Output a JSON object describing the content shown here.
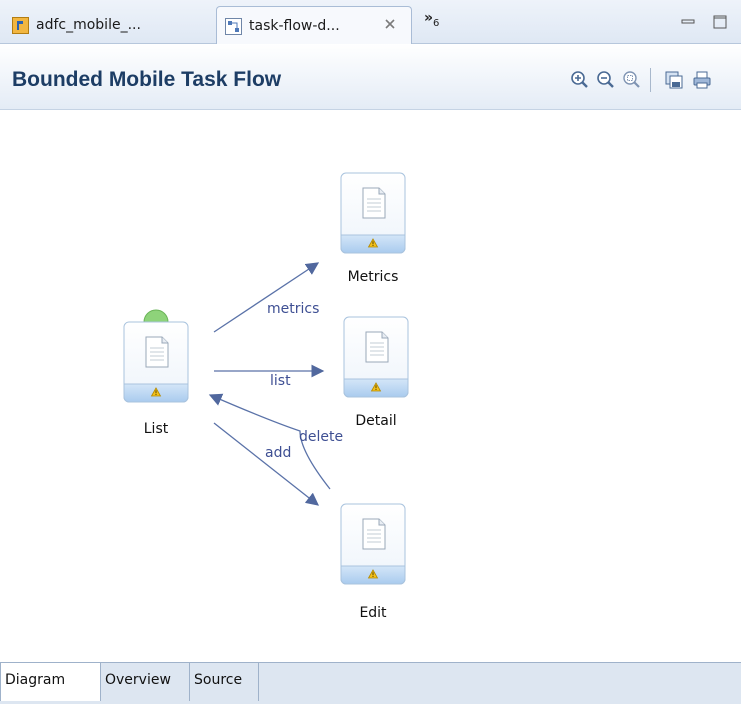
{
  "tabs": [
    {
      "label": "adfc_mobile_...",
      "active": false
    },
    {
      "label": "task-flow-d...",
      "active": true
    }
  ],
  "tab_overflow": {
    "symbol": "»",
    "count": "6"
  },
  "header": {
    "title": "Bounded Mobile Task Flow"
  },
  "toolbar": [
    "zoom-in-icon",
    "zoom-out-icon",
    "zoom-fit-icon",
    "save-image-icon",
    "print-icon"
  ],
  "diagram": {
    "nodes": [
      {
        "id": "list",
        "label": "List",
        "warning": true,
        "default_activity": true
      },
      {
        "id": "metrics",
        "label": "Metrics",
        "warning": true
      },
      {
        "id": "detail",
        "label": "Detail",
        "warning": true
      },
      {
        "id": "edit",
        "label": "Edit",
        "warning": true
      }
    ],
    "edges": [
      {
        "from": "list",
        "to": "metrics",
        "label": "metrics"
      },
      {
        "from": "list",
        "to": "detail",
        "label": "list"
      },
      {
        "from": "list",
        "to": "edit",
        "label": "add"
      },
      {
        "from": "edit",
        "to": "list",
        "label": "delete"
      }
    ]
  },
  "bottom_tabs": [
    {
      "label": "Diagram",
      "active": true
    },
    {
      "label": "Overview",
      "active": false
    },
    {
      "label": "Source",
      "active": false
    }
  ],
  "colors": {
    "title": "#1d3d65",
    "edge": "#5a72a8",
    "edge_label": "#3e4f93",
    "node_band": "#b9d4f0",
    "start_marker": "#8ed37a"
  }
}
